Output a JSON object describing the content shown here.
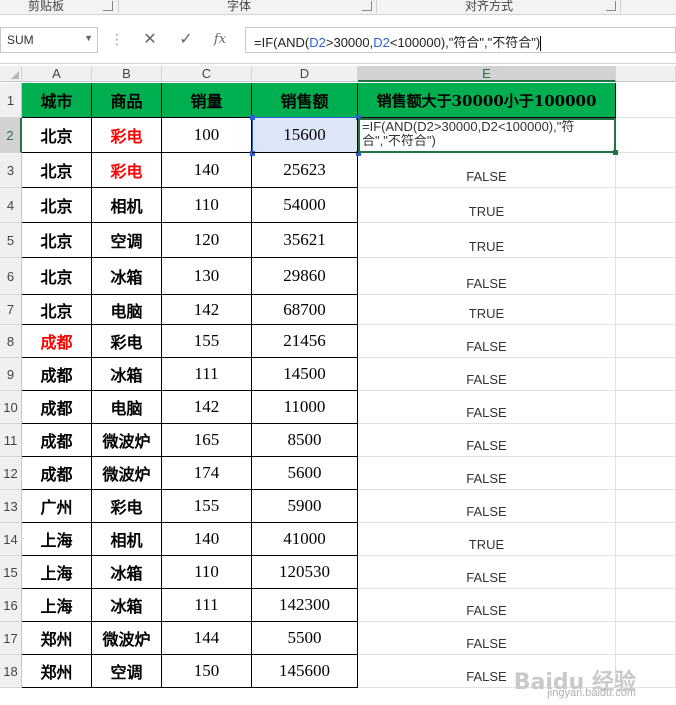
{
  "ribbon": {
    "groups": [
      "剪贴板",
      "字体",
      "对齐方式"
    ]
  },
  "formula_bar": {
    "name_box": "SUM",
    "cancel_icon": "close-icon",
    "enter_icon": "check-icon",
    "fx_label": "fx",
    "formula_parts": [
      "=IF(AND(",
      "D2",
      ">30000,",
      "D2",
      "<100000),\"符合\",\"不符合\")"
    ]
  },
  "sheet": {
    "columns": [
      "A",
      "B",
      "C",
      "D",
      "E"
    ],
    "selected_column": "E",
    "selected_row": 2,
    "header_row": [
      "城市",
      "商品",
      "销量",
      "销售额",
      "销售额大于30000小于100000"
    ],
    "rows": [
      [
        "北京",
        "彩电",
        "100",
        "15600",
        ""
      ],
      [
        "北京",
        "彩电",
        "140",
        "25623",
        "FALSE"
      ],
      [
        "北京",
        "相机",
        "110",
        "54000",
        "TRUE"
      ],
      [
        "北京",
        "空调",
        "120",
        "35621",
        "TRUE"
      ],
      [
        "北京",
        "冰箱",
        "130",
        "29860",
        "FALSE"
      ],
      [
        "北京",
        "电脑",
        "142",
        "68700",
        "TRUE"
      ],
      [
        "成都",
        "彩电",
        "155",
        "21456",
        "FALSE"
      ],
      [
        "成都",
        "冰箱",
        "111",
        "14500",
        "FALSE"
      ],
      [
        "成都",
        "电脑",
        "142",
        "11000",
        "FALSE"
      ],
      [
        "成都",
        "微波炉",
        "165",
        "8500",
        "FALSE"
      ],
      [
        "成都",
        "微波炉",
        "174",
        "5600",
        "FALSE"
      ],
      [
        "广州",
        "彩电",
        "155",
        "5900",
        "FALSE"
      ],
      [
        "上海",
        "相机",
        "140",
        "41000",
        "TRUE"
      ],
      [
        "上海",
        "冰箱",
        "110",
        "120530",
        "FALSE"
      ],
      [
        "上海",
        "冰箱",
        "111",
        "142300",
        "FALSE"
      ],
      [
        "郑州",
        "微波炉",
        "144",
        "5500",
        "FALSE"
      ],
      [
        "郑州",
        "空调",
        "150",
        "145600",
        "FALSE"
      ]
    ],
    "editing_cell_text": "=IF(AND(D2>30000,D2<100000),\"符合\",\"不符合\")",
    "red_text_color": "#ff0000",
    "header_fill_color": "#00b050",
    "selection_color": "#217346"
  },
  "watermark": {
    "logo": "Baidu 经验",
    "url": "jingyan.baidu.com"
  }
}
